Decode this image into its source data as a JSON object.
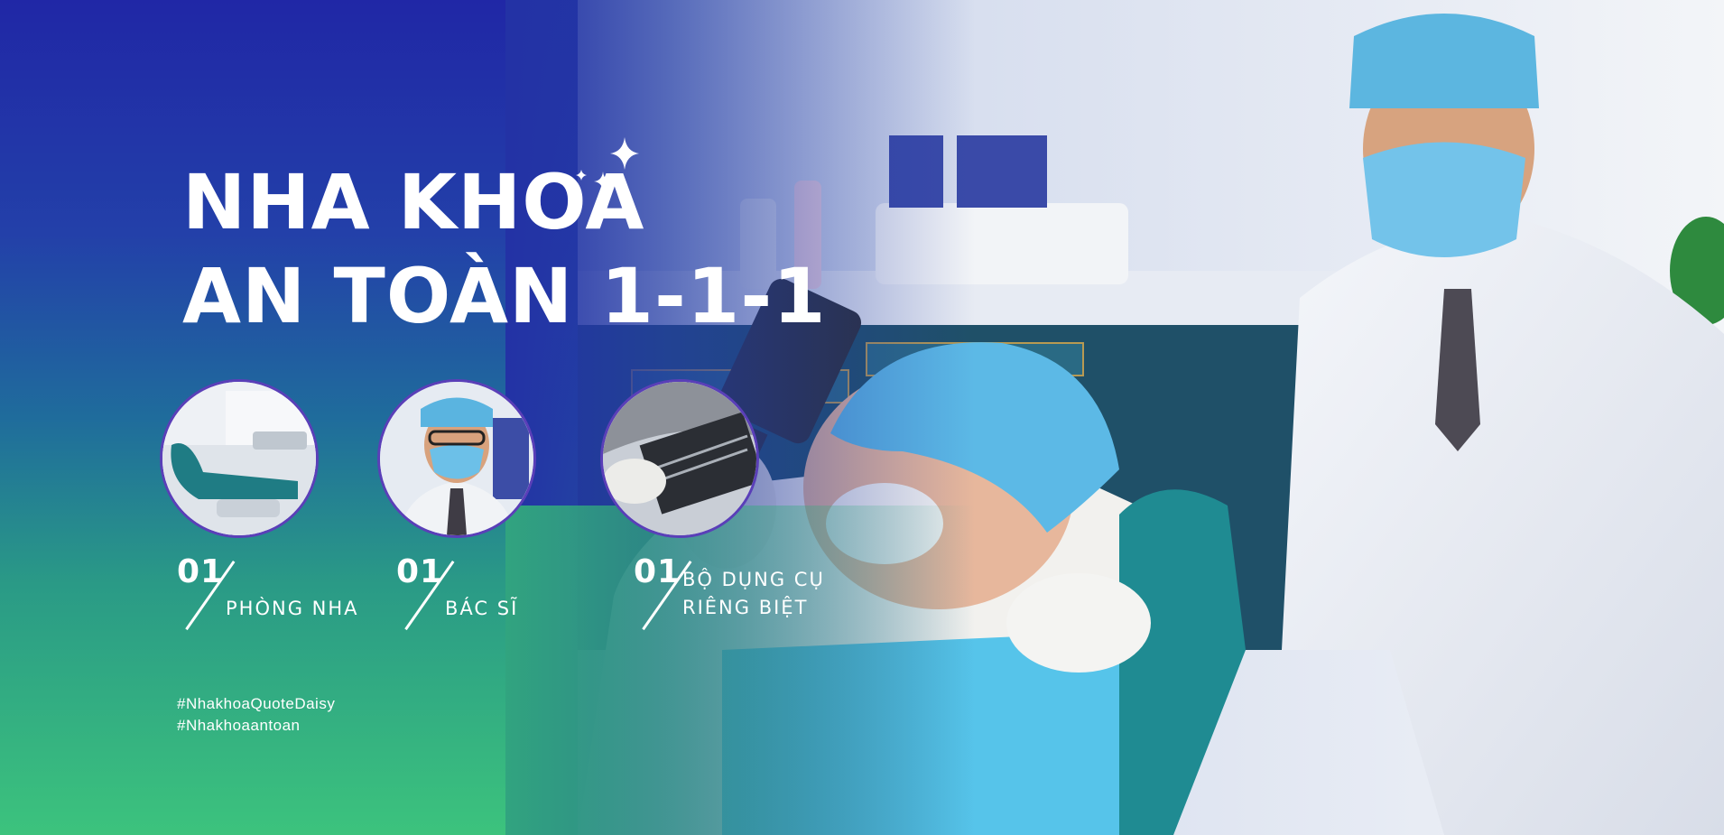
{
  "banner": {
    "title_line1": "NHA KHOA",
    "title_line2": "AN TOÀN 1-1-1",
    "features": [
      {
        "number": "01",
        "label": "PHÒNG NHA",
        "image": "dental-room-photo"
      },
      {
        "number": "01",
        "label": "BÁC SĨ",
        "image": "dentist-photo"
      },
      {
        "number": "01",
        "label_line1": "BỘ DỤNG CỤ",
        "label_line2": "RIÊNG BIỆT",
        "image": "dental-instruments-photo"
      }
    ],
    "hashtags": [
      "#NhakhoaQuoteDaisy",
      "#Nhakhoaantoan"
    ],
    "colors": {
      "top": "#2027a6",
      "bottom": "#3cc37d",
      "circle_border": "#5a3fb8",
      "text": "#ffffff"
    },
    "decoration_icon": "sparkle-icon"
  }
}
